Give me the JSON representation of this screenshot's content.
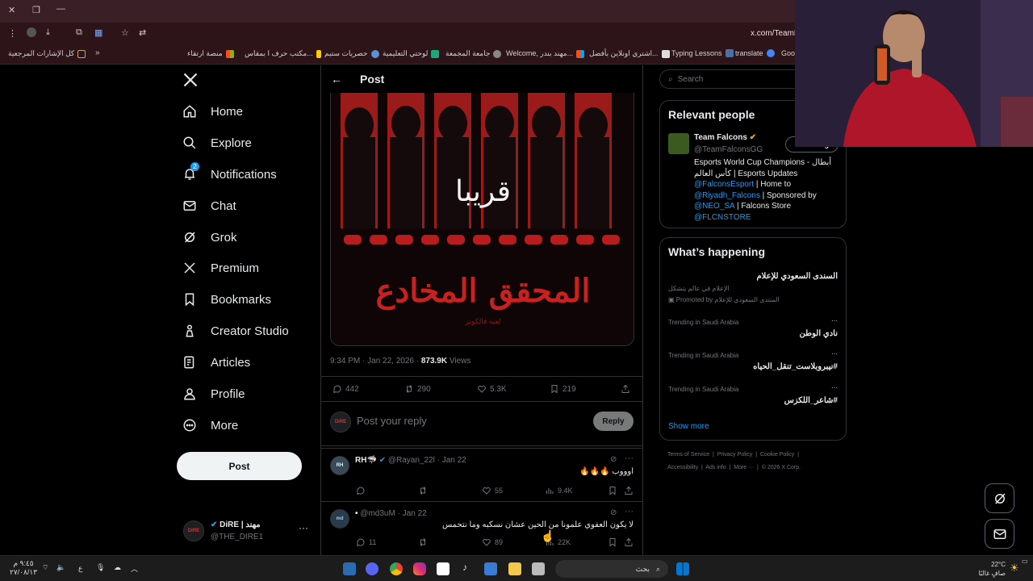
{
  "browser": {
    "address": "x.com/TeamF",
    "bookmarks": [
      {
        "label": "كل الإشارات المرجعية",
        "color": "#c8a060"
      },
      {
        "label": "منصة ارتقاء",
        "color": "#e04a2a"
      },
      {
        "label": "مكتب حرف ا بمقاس...",
        "color": "#ffcc00"
      },
      {
        "label": "حصريات ستيم",
        "color": "#5b8fd6"
      },
      {
        "label": "لوحتي التعليمية",
        "color": "#1ca87a"
      },
      {
        "label": "جامعة المجمعة",
        "color": "#888888"
      },
      {
        "label": "Welcome, مهند بندر...",
        "color": "#e04a2a"
      },
      {
        "label": "اشتري اونلاين بأفضل...",
        "color": "#222222"
      },
      {
        "label": "Typing Lessons",
        "color": "#4a6fa5"
      },
      {
        "label": "translate",
        "color": "#4285f4"
      },
      {
        "label": "Goog",
        "color": "#ffffff"
      }
    ]
  },
  "nav": {
    "items": [
      {
        "label": "Home",
        "icon": "home-icon"
      },
      {
        "label": "Explore",
        "icon": "search-icon"
      },
      {
        "label": "Notifications",
        "icon": "bell-icon",
        "badge": "2"
      },
      {
        "label": "Chat",
        "icon": "mail-icon"
      },
      {
        "label": "Grok",
        "icon": "grok-icon"
      },
      {
        "label": "Premium",
        "icon": "x-icon"
      },
      {
        "label": "Bookmarks",
        "icon": "bookmark-icon"
      },
      {
        "label": "Creator Studio",
        "icon": "creator-icon"
      },
      {
        "label": "Articles",
        "icon": "articles-icon"
      },
      {
        "label": "Profile",
        "icon": "person-icon"
      },
      {
        "label": "More",
        "icon": "more-icon"
      }
    ],
    "post_button": "Post",
    "account": {
      "name": "مهند | DiRE",
      "handle": "@THE_DIRE1"
    }
  },
  "post": {
    "header": "Post",
    "image_text_top": "قريبا",
    "image_text_bottom": "المحقق المخادع",
    "image_caption": "لعبة فالكونز",
    "timestamp": "9:34 PM · Jan 22, 2026 · ",
    "views_count": "873.9K",
    "views_label": " Views",
    "replies": "442",
    "reposts": "290",
    "likes": "5.3K",
    "bookmarks": "219",
    "reply_placeholder": "Post your reply",
    "reply_button": "Reply"
  },
  "replies": [
    {
      "name": "RH🦈",
      "handle": "@Rayan_22l · Jan 22",
      "text": "اوووب 🔥🔥🔥",
      "likes": "55",
      "views": "9.4K",
      "verified": true
    },
    {
      "name": "•",
      "handle": "@md3uM · Jan 22",
      "text": "لا يكون العفوي علمونا من الحين عشان نسكبه وما نتحمس",
      "replies": "11",
      "likes": "89",
      "views": "22K",
      "verified": false
    }
  ],
  "right": {
    "search_placeholder": "Search",
    "relevant_title": "Relevant people",
    "person": {
      "name": "Team Falcons",
      "handle": "@TeamFalconsGG",
      "follow_label": "Following",
      "bio_1": "Esports World Cup Champions - أبطال كأس العالم | Esports Updates",
      "link_1": "@FalconsEsport",
      "bio_2": " | Home to ",
      "link_2": "@Riyadh_Falcons",
      "bio_3": " | Sponsored by ",
      "link_3": "@NEO_SA",
      "bio_4": " | Falcons Store ",
      "link_4": "@FLCNSTORE"
    },
    "happening_title": "What’s happening",
    "promo": {
      "title": "السندى السعودي للإعلام",
      "subtitle": "الإعلام في عالم يتشكل",
      "promoted": "Promoted by المنتدى السعودي للإعلام"
    },
    "trends": [
      {
        "context": "Trending in Saudi Arabia",
        "title": "نادي الوطن"
      },
      {
        "context": "Trending in Saudi Arabia",
        "title": "#نيبروبلاست_تنقل_الحياه"
      },
      {
        "context": "Trending in Saudi Arabia",
        "title": "#شاعر_اللكزس"
      }
    ],
    "show_more": "Show more",
    "footer_1": [
      "Terms of Service",
      "Privacy Policy",
      "Cookie Policy"
    ],
    "footer_2": [
      "Accessibility",
      "Ads info",
      "More ···",
      "© 2026 X Corp."
    ]
  },
  "taskbar": {
    "time": "٩:٤٥ م",
    "date": "٢٧/٠٨/١٣",
    "lang": "ع",
    "search_placeholder": "بحث",
    "weather_temp": "22°C",
    "weather_desc": "صافٍ غالبًا"
  }
}
